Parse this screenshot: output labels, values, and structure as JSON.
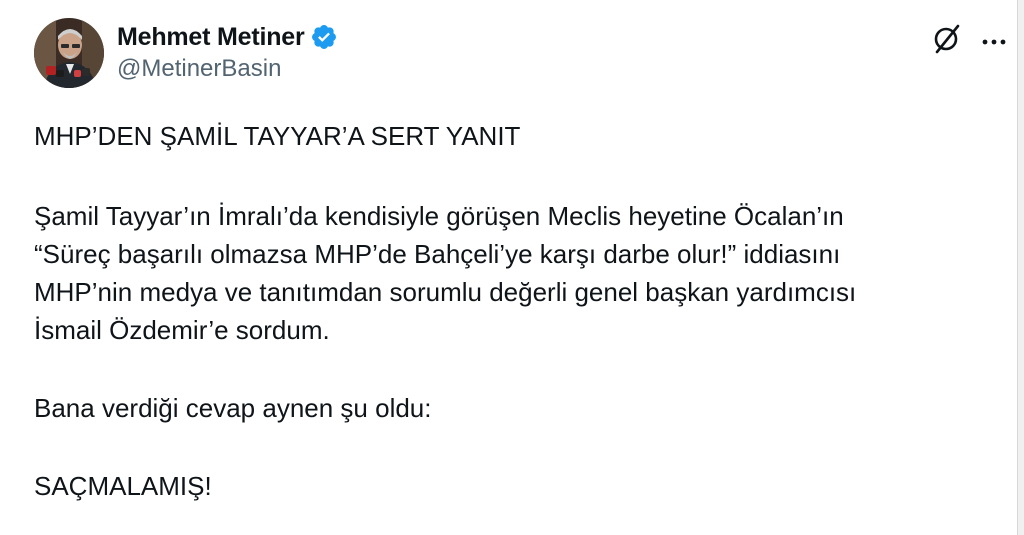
{
  "author": {
    "display_name": "Mehmet Metiner",
    "handle": "@MetinerBasin",
    "verified": true,
    "verified_color": "#1d9bf0"
  },
  "icons": {
    "avatar": "avatar-photo",
    "verified": "verified-badge-icon",
    "grok": "grok-icon",
    "more": "more-options-icon"
  },
  "tweet": {
    "headline": "MHP’DEN ŞAMİL TAYYAR’A SERT YANIT",
    "paragraph_lines": [
      "Şamil Tayyar’ın İmralı’da kendisiyle görüşen Meclis heyetine Öcalan’ın",
      "“Süreç başarılı olmazsa MHP’de Bahçeli’ye karşı darbe olur!” iddiasını",
      "MHP’nin medya ve tanıtımdan sorumlu değerli genel başkan yardımcısı",
      "İsmail Özdemir’e sordum."
    ],
    "reply_intro": "Bana verdiği cevap aynen şu oldu:",
    "reply": "SAÇMALAMIŞ!"
  }
}
